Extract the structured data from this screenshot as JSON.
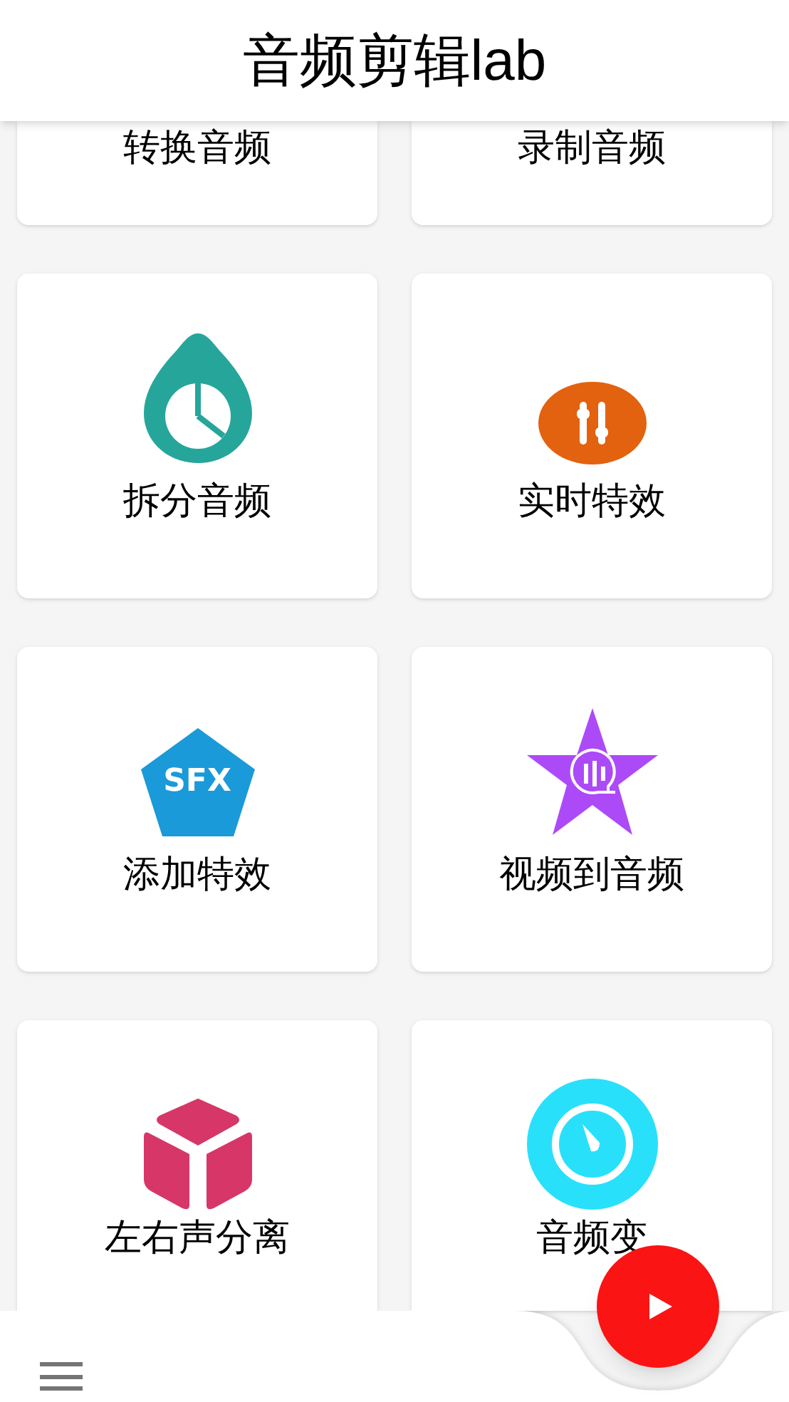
{
  "app_bar": {
    "title": "音频剪辑lab"
  },
  "cards": [
    {
      "label": "转换音频",
      "kind": "partial"
    },
    {
      "label": "录制音频",
      "kind": "partial"
    },
    {
      "label": "拆分音频",
      "kind": "drop-chart"
    },
    {
      "label": "实时特效",
      "kind": "sliders"
    },
    {
      "label": "添加特效",
      "kind": "sfx",
      "icon_text": "SFX"
    },
    {
      "label": "视频到音频",
      "kind": "star-wave"
    },
    {
      "label": "左右声分离",
      "kind": "cube"
    },
    {
      "label": "音频变",
      "kind": "gauge"
    }
  ]
}
